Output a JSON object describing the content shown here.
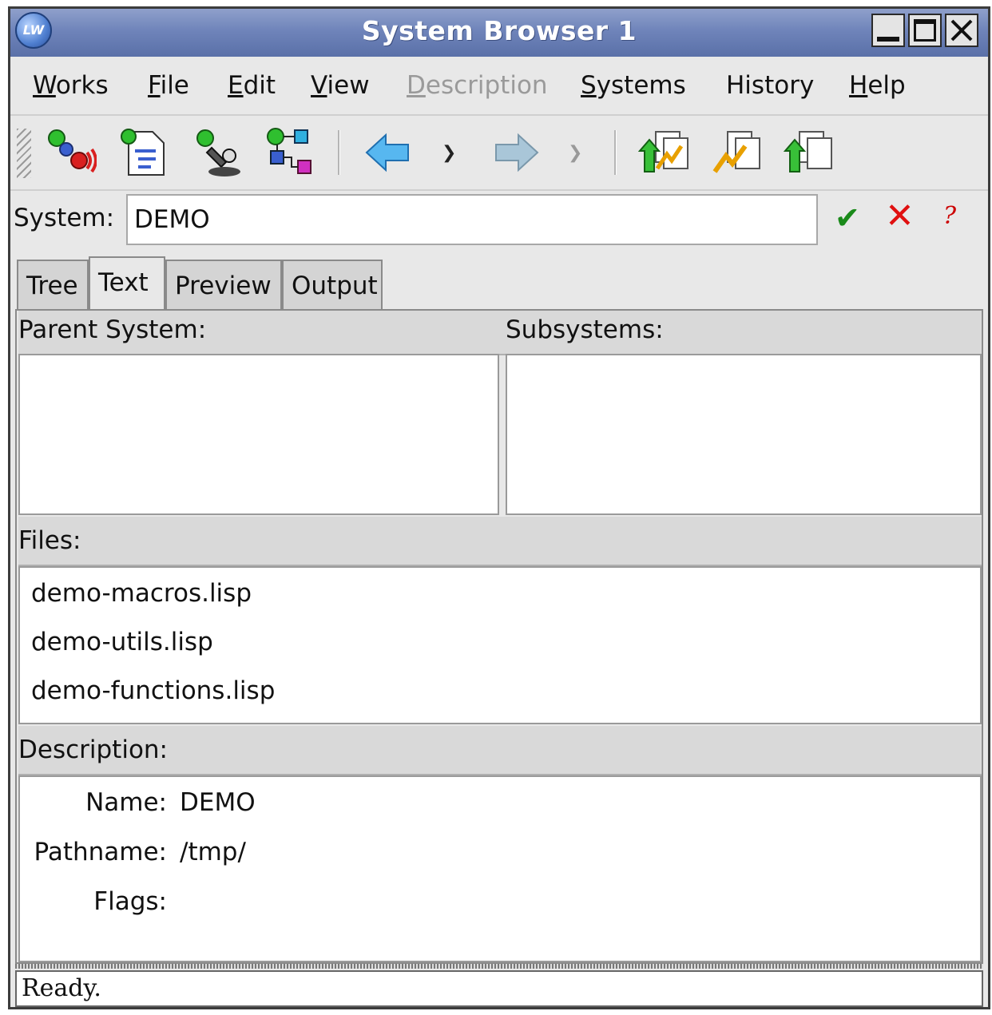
{
  "window": {
    "title": "System Browser 1",
    "app_icon": "LW"
  },
  "menubar": {
    "items": [
      {
        "label": "Works"
      },
      {
        "label": "File"
      },
      {
        "label": "Edit"
      },
      {
        "label": "View"
      },
      {
        "label": "Description",
        "disabled": true
      },
      {
        "label": "Systems"
      },
      {
        "label": "History"
      },
      {
        "label": "Help"
      }
    ]
  },
  "toolbar": {
    "buttons": [
      {
        "icon": "system-tool-icon"
      },
      {
        "icon": "document-tool-icon"
      },
      {
        "icon": "inspect-tool-icon"
      },
      {
        "icon": "tree-tool-icon"
      },
      {
        "icon": "back-arrow-icon"
      },
      {
        "icon": "forward-arrow-icon"
      },
      {
        "icon": "compile-load-icon"
      },
      {
        "icon": "compile-icon"
      },
      {
        "icon": "load-icon"
      }
    ]
  },
  "system": {
    "label": "System:",
    "value": "DEMO"
  },
  "tabs": [
    {
      "label": "Tree"
    },
    {
      "label": "Text",
      "active": true
    },
    {
      "label": "Preview"
    },
    {
      "label": "Output"
    }
  ],
  "panel": {
    "parent_label": "Parent System:",
    "subsystems_label": "Subsystems:",
    "files_label": "Files:",
    "files": [
      "demo-macros.lisp",
      "demo-utils.lisp",
      "demo-functions.lisp"
    ],
    "description_label": "Description:",
    "description": {
      "name_key": "Name:",
      "name_value": "DEMO",
      "path_key": "Pathname:",
      "path_value": "/tmp/",
      "flags_key": "Flags:",
      "flags_value": ""
    }
  },
  "status": {
    "text": "Ready."
  },
  "colors": {
    "title_bar": "#6f84ba",
    "ok": "#1a8a1a",
    "cancel": "#e01010"
  }
}
